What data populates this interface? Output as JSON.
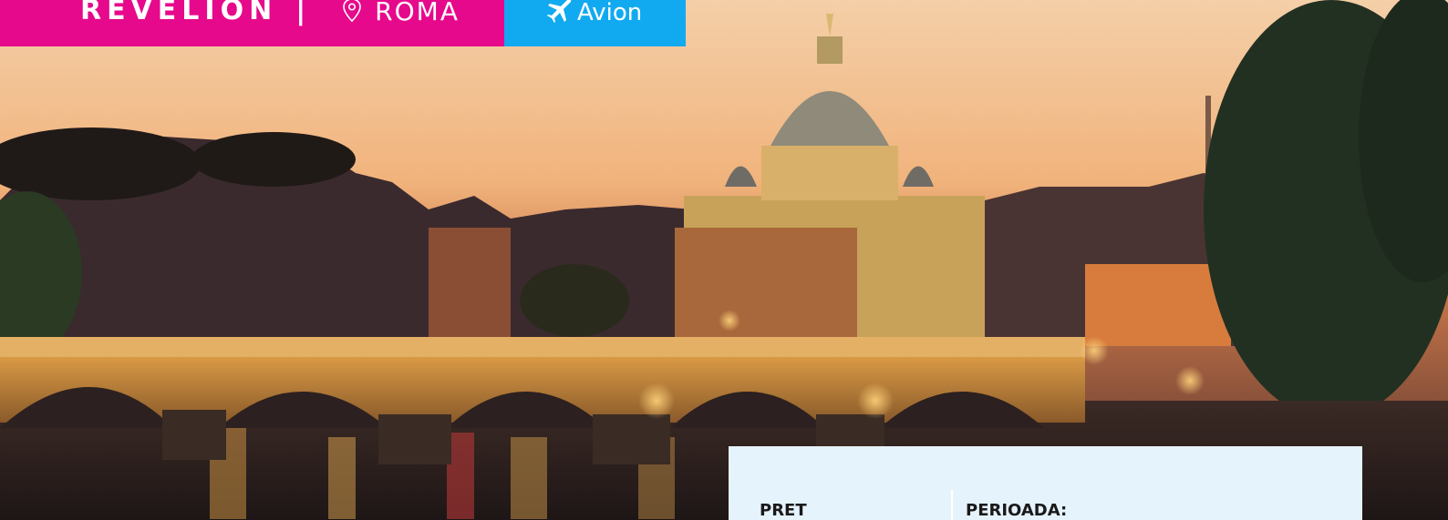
{
  "tagbar": {
    "title": "REVELION",
    "separator": "|",
    "city": "ROMA",
    "transport": "Avion",
    "colors": {
      "left_bg": "#e6098c",
      "right_bg": "#11aaf0"
    },
    "icons": {
      "location": "map-pin-icon",
      "transport": "airplane-icon"
    }
  },
  "hero": {
    "image": "rome-st-peters-basilica-ponte-sant-angelo-dusk"
  },
  "info": {
    "price_label": "PRET",
    "period_label": "PERIOADA:",
    "background": "#e5f3fc"
  }
}
